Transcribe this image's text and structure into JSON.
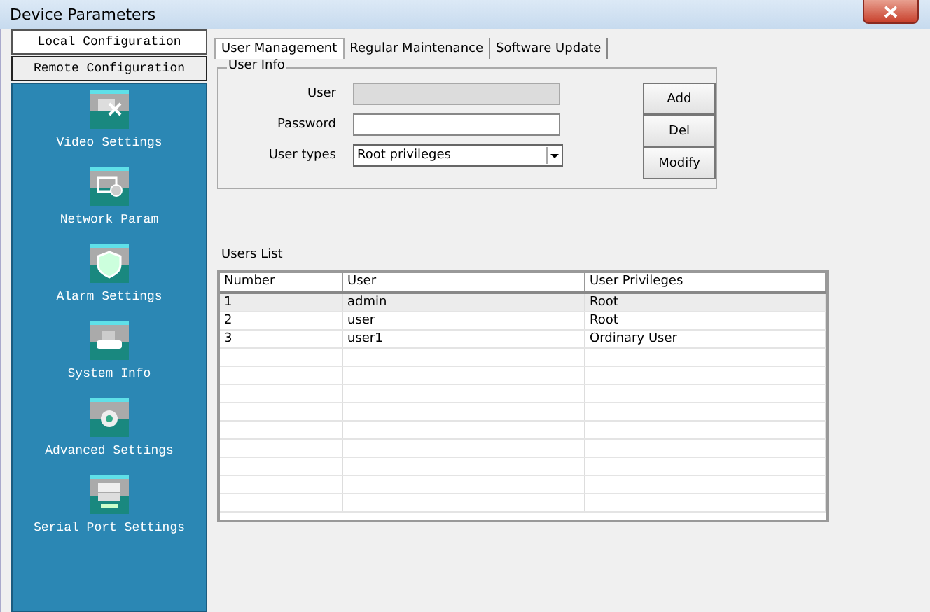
{
  "window": {
    "title": "Device Parameters"
  },
  "sidebar": {
    "sections": [
      {
        "label": "Local Configuration",
        "selected": false
      },
      {
        "label": "Remote Configuration",
        "selected": true
      }
    ],
    "items": [
      {
        "label": "Video Settings",
        "kind": "video"
      },
      {
        "label": "Network Param",
        "kind": "network"
      },
      {
        "label": "Alarm Settings",
        "kind": "alarm"
      },
      {
        "label": "System Info",
        "kind": "system"
      },
      {
        "label": "Advanced Settings",
        "kind": "advanced"
      },
      {
        "label": "Serial Port Settings",
        "kind": "serial"
      }
    ]
  },
  "tabs": [
    {
      "label": "User Management",
      "selected": true
    },
    {
      "label": "Regular Maintenance",
      "selected": false
    },
    {
      "label": "Software Update",
      "selected": false
    }
  ],
  "user_info": {
    "title": "User Info",
    "fields": [
      {
        "label": "User",
        "kind": "text",
        "disabled": true
      },
      {
        "label": "Password",
        "kind": "text",
        "disabled": false
      },
      {
        "label": "User types",
        "kind": "select",
        "value": "Root privileges",
        "disabled": false
      }
    ],
    "buttons": [
      "Add",
      "Del",
      "Modify"
    ]
  },
  "users_list": {
    "title": "Users List",
    "columns": [
      "Number",
      "User",
      "User Privileges"
    ],
    "rows": [
      {
        "cells": [
          "1",
          "admin",
          "Root"
        ],
        "selected": true
      },
      {
        "cells": [
          "2",
          "user",
          "Root"
        ],
        "selected": false
      },
      {
        "cells": [
          "3",
          "user1",
          "Ordinary User"
        ],
        "selected": false
      }
    ]
  }
}
